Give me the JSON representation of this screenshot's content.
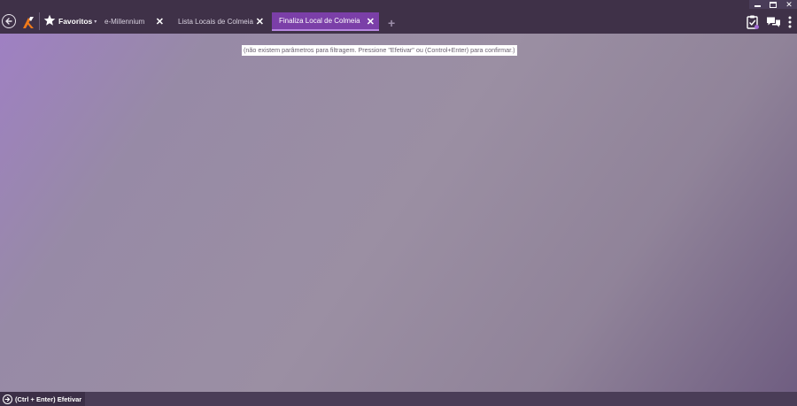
{
  "window_controls": {
    "minimize_icon": "minimize-icon",
    "maximize_icon": "maximize-icon",
    "close_glyph": "✕"
  },
  "header": {
    "back_icon": "back-arrow-icon",
    "logo_icon": "millennium-logo-icon",
    "favorites": {
      "label": "Favoritos",
      "caret": "▾"
    },
    "tabs": [
      {
        "label": "e-Millennium",
        "close": "✕",
        "active": false
      },
      {
        "label": "Lista Locais de Colmeia",
        "close": "✕",
        "active": false
      },
      {
        "label": "Finaliza Local de Colmeia",
        "close": "✕",
        "active": true
      }
    ],
    "add_tab_glyph": "+",
    "right_icons": [
      "clipboard-check-icon",
      "chat-bubbles-icon",
      "more-vert-icon"
    ]
  },
  "main": {
    "filter_message": "(não existem parâmetros para filtragem. Pressione \"Efetivar\" ou (Control+Enter) para confirmar.)"
  },
  "footer": {
    "execute_label": "(Ctrl + Enter) Efetivar",
    "execute_icon": "arrow-circle-right-icon"
  },
  "colors": {
    "topbar": "#3f3148",
    "active_tab": "#7b3fa8",
    "bottombar": "#4a3d57",
    "logo_orange": "#f07a1a"
  }
}
